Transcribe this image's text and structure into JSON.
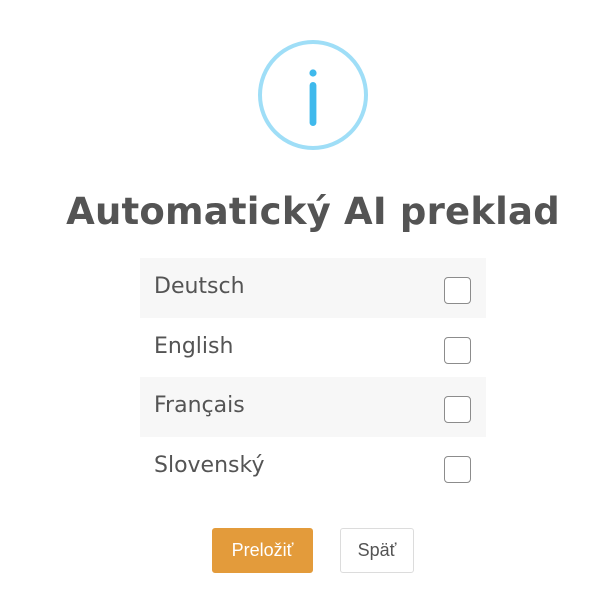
{
  "dialog": {
    "icon": "info-icon",
    "title": "Automatický AI preklad",
    "languages": [
      {
        "label": "Deutsch",
        "checked": false
      },
      {
        "label": "English",
        "checked": false
      },
      {
        "label": "Français",
        "checked": false
      },
      {
        "label": "Slovenský",
        "checked": false
      }
    ],
    "buttons": {
      "translate_label": "Preložiť",
      "back_label": "Späť"
    }
  },
  "colors": {
    "icon_ring": "#9fdef7",
    "icon_glyph": "#3fb9ec",
    "title": "#545454",
    "primary_button": "#e39b3b",
    "row_shade": "#f7f7f7"
  }
}
